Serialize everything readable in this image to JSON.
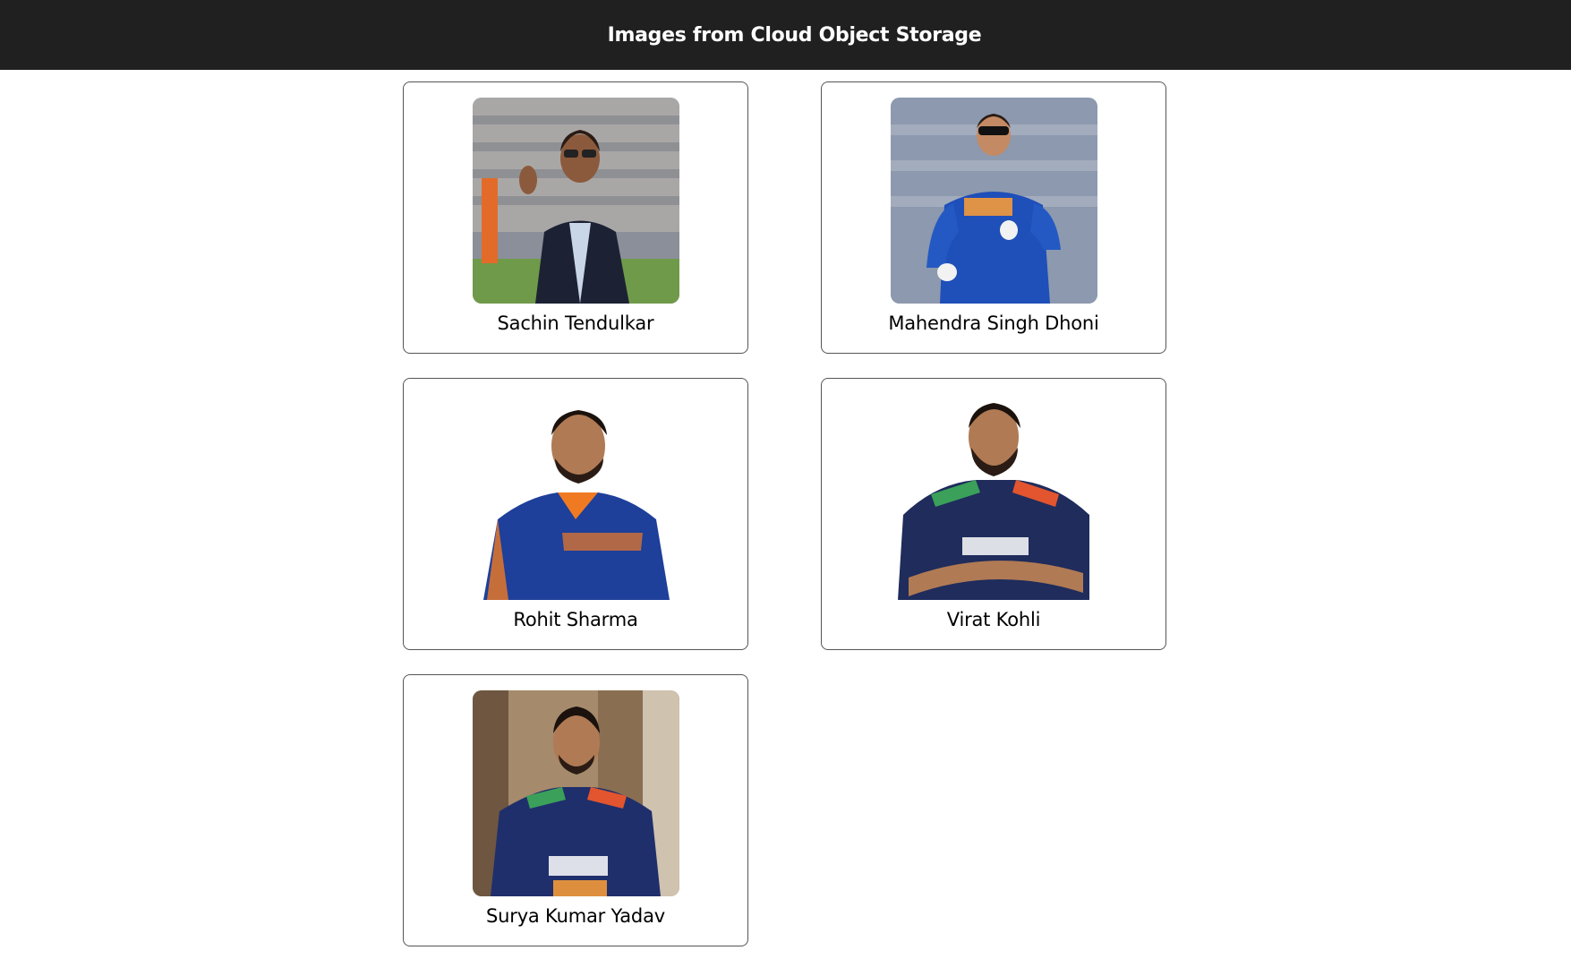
{
  "header": {
    "title": "Images from Cloud Object Storage"
  },
  "colors": {
    "header_bg": "#202020",
    "header_text": "#ffffff",
    "india_blue": "#1f4fb8",
    "card_border": "#555555"
  },
  "cards": [
    {
      "name": "Sachin Tendulkar",
      "photo_icon": "person-photo"
    },
    {
      "name": "Mahendra Singh Dhoni",
      "photo_icon": "person-photo"
    },
    {
      "name": "Rohit Sharma",
      "photo_icon": "person-photo"
    },
    {
      "name": "Virat Kohli",
      "photo_icon": "person-photo"
    },
    {
      "name": "Surya Kumar Yadav",
      "photo_icon": "person-photo"
    }
  ]
}
